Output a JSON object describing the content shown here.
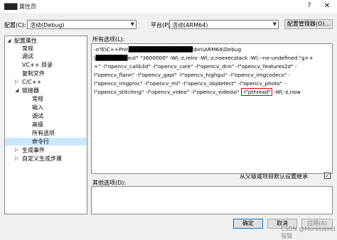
{
  "window": {
    "title": "███ 属性页",
    "help_glyph": "?",
    "close_glyph": "✕"
  },
  "toolbar": {
    "config_label": "配置(C):",
    "config_value": "活动(Debug)",
    "platform_label": "平台(P):",
    "platform_value": "活动(ARM64)",
    "config_manager_label": "配置管理器(O)..."
  },
  "tree": {
    "items": [
      {
        "label": "配置属性",
        "toggle": "◢"
      },
      {
        "label": "常规"
      },
      {
        "label": "调试"
      },
      {
        "label": "VC++ 目录"
      },
      {
        "label": "复制文件"
      },
      {
        "label": "C/C++",
        "toggle": "▷"
      },
      {
        "label": "链接器",
        "toggle": "◢"
      },
      {
        "label": "常规"
      },
      {
        "label": "输入"
      },
      {
        "label": "调试"
      },
      {
        "label": "高级"
      },
      {
        "label": "所有选项"
      },
      {
        "label": "命令行"
      },
      {
        "label": "生成事件",
        "toggle": "▷"
      },
      {
        "label": "自定义生成步骤",
        "toggle": "▷"
      }
    ]
  },
  "all_options": {
    "label": "所有选项(L):",
    "lines": [
      "-o\"E\\C++Pro\\████████████████\\bin\\ARM64\\Debug",
      "\\████████out\" \"3600000\" -Wl,-z,relro -Wl,-z,noexecstack -Wl,--no-undefined \"g++",
      "+\" -l\"opencv_calib3d\" -l\"opencv_core\" -l\"opencv_dnn\" -l\"opencv_features2d\" -",
      "l\"opencv_flann\" -l\"opencv_gapi\" -l\"opencv_highgui\" -l\"opencv_imgcodecs\" -",
      "l\"opencv_imgproc\" -l\"opencv_ml\" -l\"opencv_objdetect\" -l\"opencv_photo\" -",
      "l\"opencv_stitching\" -l\"opencv_video\" -l\"opencv_videoio\" ",
      "-l\"pthread\"",
      " -Wl,-z,now"
    ]
  },
  "other_options": {
    "label": "其他选项(D):",
    "inherit_label": "从父级或项目默认设置继承",
    "inherit_checked": "✓",
    "value": ""
  },
  "footer": {
    "ok_label": "确定",
    "cancel_label": "取消",
    "apply_label": "应用(A)"
  },
  "watermark": "CSDN @Moresweet猫猫"
}
